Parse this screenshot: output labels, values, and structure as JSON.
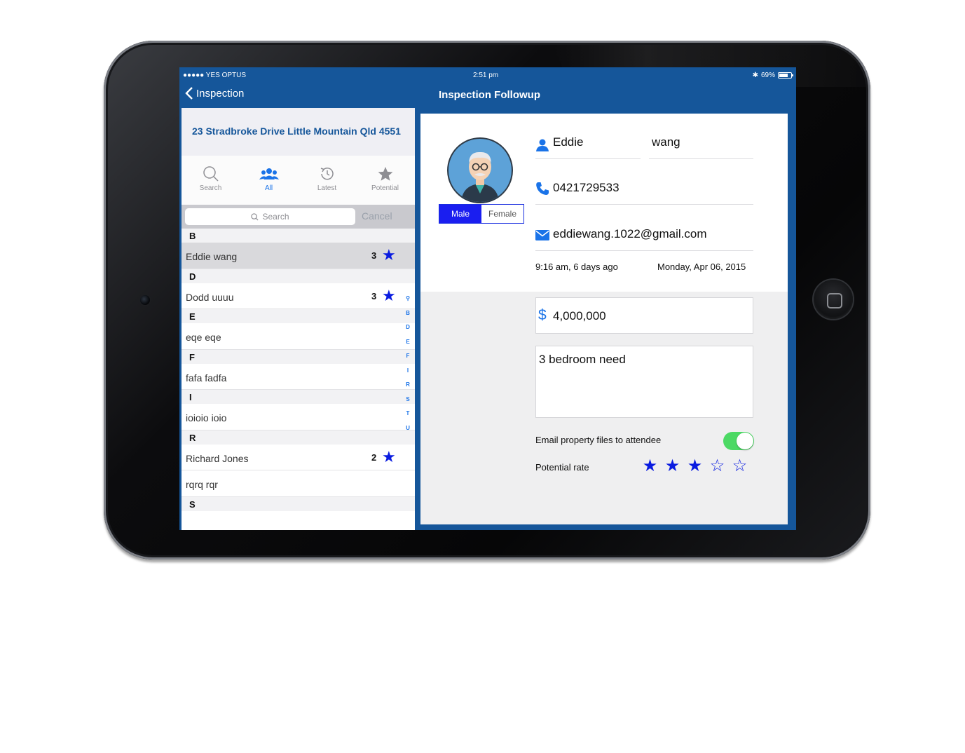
{
  "status_bar": {
    "carrier": "●●●●● YES OPTUS",
    "time": "2:51 pm",
    "battery": "69%"
  },
  "nav": {
    "back_label": "Inspection",
    "title": "Inspection Followup"
  },
  "left_panel": {
    "address": "23 Stradbroke Drive Little Mountain Qld 4551",
    "tabs": [
      {
        "label": "Search",
        "icon": "search-icon"
      },
      {
        "label": "All",
        "icon": "group-icon",
        "active": true
      },
      {
        "label": "Latest",
        "icon": "history-icon"
      },
      {
        "label": "Potential",
        "icon": "star-icon"
      }
    ],
    "search_placeholder": "Search",
    "cancel_label": "Cancel",
    "sections": [
      {
        "letter": "B",
        "rows": [
          {
            "name": "Eddie wang",
            "count": "3",
            "starred": true,
            "selected": true
          }
        ]
      },
      {
        "letter": "D",
        "rows": [
          {
            "name": "Dodd uuuu",
            "count": "3",
            "starred": true
          }
        ]
      },
      {
        "letter": "E",
        "rows": [
          {
            "name": "eqe eqe"
          }
        ]
      },
      {
        "letter": "F",
        "rows": [
          {
            "name": "fafa fadfa"
          }
        ]
      },
      {
        "letter": "I",
        "rows": [
          {
            "name": "ioioio ioio"
          }
        ]
      },
      {
        "letter": "R",
        "rows": [
          {
            "name": "Richard Jones",
            "count": "2",
            "starred": true
          },
          {
            "name": "rqrq rqr"
          }
        ]
      },
      {
        "letter": "S",
        "rows": []
      }
    ],
    "index_letters": [
      "B",
      "D",
      "E",
      "F",
      "I",
      "R",
      "S",
      "T",
      "U"
    ]
  },
  "detail": {
    "gender_options": [
      "Male",
      "Female"
    ],
    "gender_selected": "Male",
    "first_name": "Eddie",
    "last_name": "wang",
    "phone": "0421729533",
    "email": "eddiewang.1022@gmail.com",
    "relative_time": "9:16 am, 6 days ago",
    "date": "Monday, Apr 06, 2015",
    "price_symbol": "$",
    "price": "4,000,000",
    "notes": "3 bedroom need",
    "email_files_label": "Email property files to attendee",
    "email_files_on": true,
    "potential_rate_label": "Potential rate",
    "potential_rate": 3,
    "potential_rate_max": 5
  },
  "colors": {
    "nav_blue": "#15569a",
    "accent_blue": "#1a73e8",
    "star_blue": "#0a1ce0",
    "toggle_green": "#4cd964"
  }
}
